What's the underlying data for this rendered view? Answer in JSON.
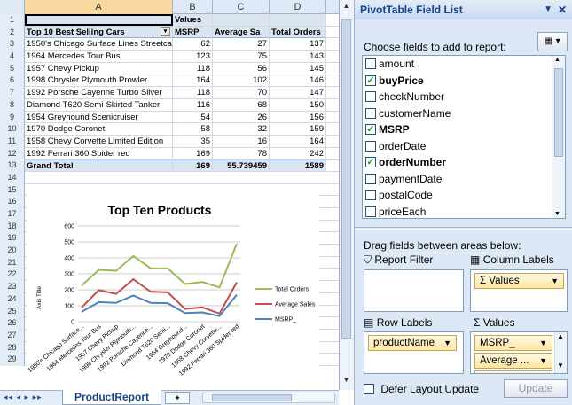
{
  "columns": [
    "A",
    "B",
    "C",
    "D"
  ],
  "row_numbers": [
    "1",
    "2",
    "3",
    "4",
    "5",
    "6",
    "7",
    "8",
    "9",
    "10",
    "11",
    "12",
    "13",
    "14",
    "15",
    "16",
    "17",
    "18",
    "19",
    "20",
    "21",
    "22",
    "23",
    "24",
    "25",
    "26",
    "27",
    "28",
    "29"
  ],
  "pivot": {
    "values_label": "Values",
    "headers": [
      "Top 10 Best Selling Cars",
      "MSRP_",
      "Average Sa",
      "Total Orders"
    ],
    "rows": [
      [
        "1950's Chicago Surface Lines Streetca",
        "62",
        "27",
        "137"
      ],
      [
        "1964 Mercedes Tour Bus",
        "123",
        "75",
        "143"
      ],
      [
        "1957 Chevy Pickup",
        "118",
        "56",
        "145"
      ],
      [
        "1998 Chrysler Plymouth Prowler",
        "164",
        "102",
        "146"
      ],
      [
        "1992 Porsche Cayenne Turbo Silver",
        "118",
        "70",
        "147"
      ],
      [
        "Diamond T620 Semi-Skirted Tanker",
        "116",
        "68",
        "150"
      ],
      [
        "1954 Greyhound Scenicruiser",
        "54",
        "26",
        "156"
      ],
      [
        "1970 Dodge Coronet",
        "58",
        "32",
        "159"
      ],
      [
        "1958 Chevy Corvette Limited Edition",
        "35",
        "16",
        "164"
      ],
      [
        "1992 Ferrari 360 Spider red",
        "169",
        "78",
        "242"
      ]
    ],
    "total": [
      "Grand Total",
      "169",
      "55.739459",
      "1589"
    ]
  },
  "chart_data": {
    "type": "line",
    "title": "Top Ten Products",
    "ylabel": "Axis Title",
    "ylim": [
      0,
      600
    ],
    "yticks": [
      "0",
      "100",
      "200",
      "300",
      "400",
      "500",
      "600"
    ],
    "categories": [
      "1950's Chicago Surface...",
      "1964 Mercedes Tour Bus",
      "1957 Chevy Pickup",
      "1998 Chrysler Plymouth...",
      "1992 Porsche Cayenne...",
      "Diamond T620 Semi...",
      "1954 Greyhound...",
      "1970 Dodge Coronet",
      "1958 Chevy Corvette...",
      "1992 Ferrari 360 Spider red"
    ],
    "series": [
      {
        "name": "Total Orders",
        "color": "#9bbb59",
        "values": [
          226,
          325,
          319,
          412,
          335,
          334,
          236,
          249,
          215,
          489
        ]
      },
      {
        "name": "Average Sales",
        "color": "#c0504d",
        "values": [
          89,
          198,
          174,
          266,
          188,
          184,
          80,
          90,
          51,
          247
        ]
      },
      {
        "name": "MSRP_",
        "color": "#4f81bd",
        "values": [
          62,
          123,
          118,
          164,
          118,
          116,
          54,
          58,
          35,
          169
        ]
      }
    ]
  },
  "sheet_tab": "ProductReport",
  "pane": {
    "title": "PivotTable Field List",
    "choose_label": "Choose fields to add to report:",
    "fields": [
      {
        "name": "amount",
        "checked": false
      },
      {
        "name": "buyPrice",
        "checked": true
      },
      {
        "name": "checkNumber",
        "checked": false
      },
      {
        "name": "customerName",
        "checked": false
      },
      {
        "name": "MSRP",
        "checked": true
      },
      {
        "name": "orderDate",
        "checked": false
      },
      {
        "name": "orderNumber",
        "checked": true
      },
      {
        "name": "paymentDate",
        "checked": false
      },
      {
        "name": "postalCode",
        "checked": false
      },
      {
        "name": "priceEach",
        "checked": false
      }
    ],
    "drag_label": "Drag fields between areas below:",
    "report_filter": "Report Filter",
    "column_labels": "Column Labels",
    "column_chip": "Σ Values",
    "row_labels": "Row Labels",
    "values_area": "Values",
    "row_chip": "productName",
    "value_chips": [
      "MSRP_",
      "Average ..."
    ],
    "defer_label": "Defer Layout Update",
    "update_label": "Update"
  }
}
